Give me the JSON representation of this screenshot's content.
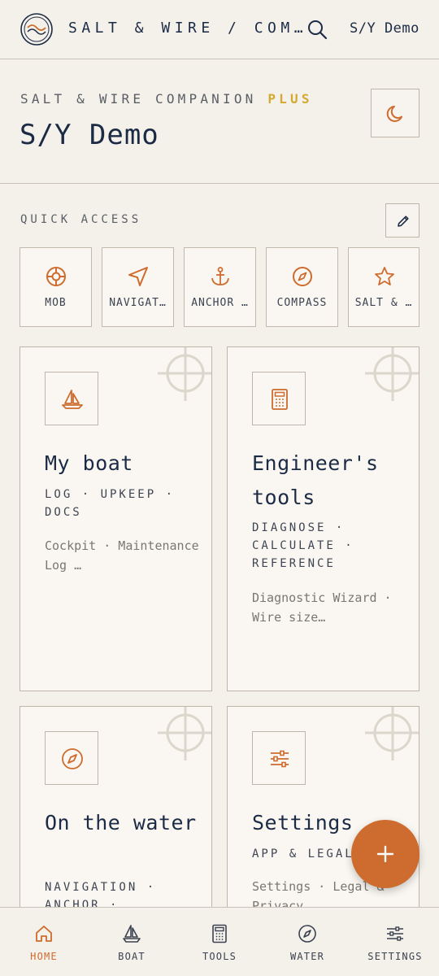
{
  "topbar": {
    "app_title": "SALT & WIRE / COM…",
    "vessel": "S/Y Demo"
  },
  "header": {
    "companion": "SALT & WIRE COMPANION",
    "plus": "PLUS",
    "vessel_name": "S/Y Demo"
  },
  "quick_access": {
    "label": "QUICK ACCESS",
    "items": [
      {
        "label": "MOB",
        "icon": "lifebuoy-icon"
      },
      {
        "label": "NAVIGAT…",
        "icon": "navigation-arrow-icon"
      },
      {
        "label": "ANCHOR …",
        "icon": "anchor-icon"
      },
      {
        "label": "COMPASS",
        "icon": "compass-icon"
      },
      {
        "label": "SALT & …",
        "icon": "star-icon"
      }
    ]
  },
  "cards": [
    {
      "title": "My boat",
      "tags": "LOG · UPKEEP · DOCS",
      "desc": "Cockpit · Maintenance Log …",
      "icon": "sailboat-icon"
    },
    {
      "title": "Engineer's tools",
      "tags": "DIAGNOSE · CALCULATE · REFERENCE",
      "desc": "Diagnostic Wizard · Wire size…",
      "icon": "calculator-icon"
    },
    {
      "title": "On the water",
      "tags": "NAVIGATION · ANCHOR ·",
      "desc": "",
      "icon": "compass-icon"
    },
    {
      "title": "Settings",
      "tags": "APP & LEGAL",
      "desc": "Settings · Legal & Privacy",
      "icon": "sliders-icon"
    }
  ],
  "bottom_nav": [
    {
      "label": "HOME",
      "icon": "home-icon",
      "active": true
    },
    {
      "label": "BOAT",
      "icon": "sailboat-icon"
    },
    {
      "label": "TOOLS",
      "icon": "calculator-icon"
    },
    {
      "label": "WATER",
      "icon": "compass-icon"
    },
    {
      "label": "SETTINGS",
      "icon": "sliders-icon"
    }
  ],
  "colors": {
    "accent": "#cd6c2e",
    "plus": "#d4aa32",
    "ink": "#1c2b45",
    "background": "#f4f0ea"
  }
}
